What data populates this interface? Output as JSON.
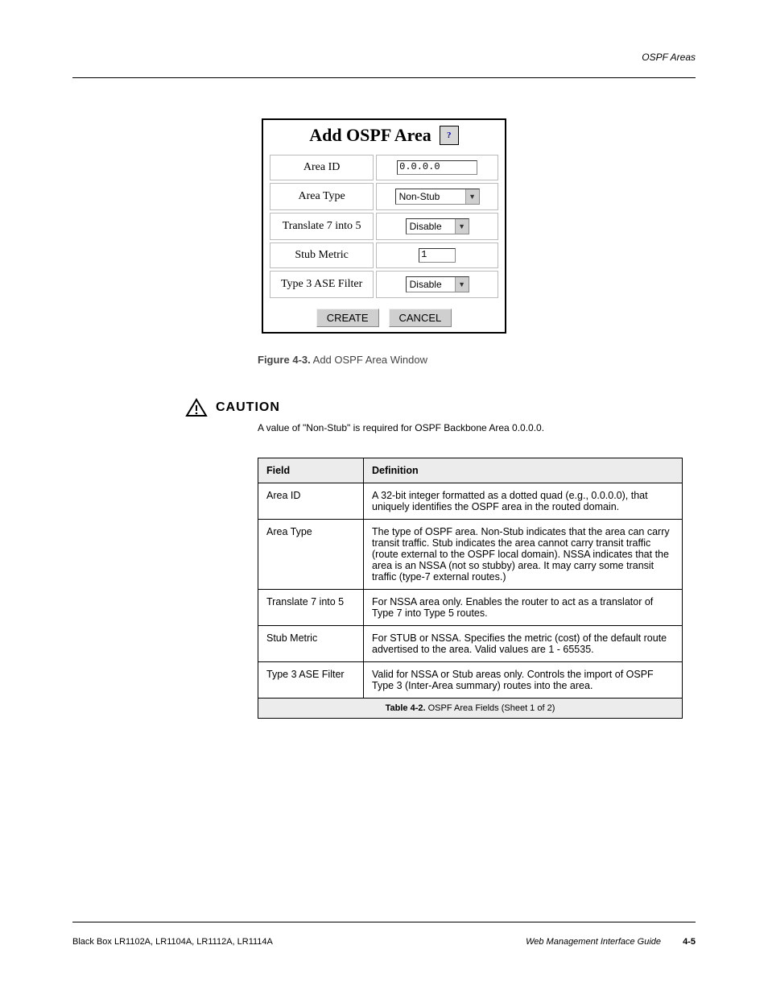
{
  "header": {
    "running_title": "OSPF Areas"
  },
  "screenshot": {
    "title": "Add OSPF Area",
    "help_icon_label": "?",
    "fields": {
      "area_id": {
        "label": "Area ID",
        "value": "0.0.0.0"
      },
      "area_type": {
        "label": "Area Type",
        "value": "Non-Stub"
      },
      "translate": {
        "label": "Translate 7 into 5",
        "value": "Disable"
      },
      "stub_metric": {
        "label": "Stub Metric",
        "value": "1"
      },
      "type3_filter": {
        "label": "Type 3 ASE Filter",
        "value": "Disable"
      }
    },
    "buttons": {
      "create": "CREATE",
      "cancel": "CANCEL"
    }
  },
  "figure_caption": {
    "label": "Figure 4-3.",
    "text": "Add OSPF Area Window"
  },
  "caution": {
    "word": "CAUTION",
    "text": "A value of \"Non-Stub\" is required for OSPF Backbone Area 0.0.0.0."
  },
  "fields_table": {
    "headers": {
      "col1": "Field",
      "col2": "Definition"
    },
    "rows": [
      {
        "field": "Area ID",
        "definition": "A 32-bit integer formatted as a dotted quad (e.g., 0.0.0.0), that uniquely identifies the OSPF area in the routed domain."
      },
      {
        "field": "Area Type",
        "definition": "The type of OSPF area. Non-Stub indicates that the area can carry transit traffic. Stub indicates the area cannot carry transit traffic (route external to the OSPF local domain). NSSA indicates that the area is an NSSA (not so stubby) area. It may carry some transit traffic (type-7 external routes.)"
      },
      {
        "field": "Translate 7 into 5",
        "definition": "For NSSA area only. Enables the router to act as a translator of Type 7 into Type 5 routes."
      },
      {
        "field": "Stub Metric",
        "definition": "For STUB or NSSA. Specifies the metric (cost) of the default route advertised to the area. Valid values are 1 - 65535."
      },
      {
        "field": "Type 3 ASE Filter",
        "definition": "Valid for NSSA or Stub areas only. Controls the import of OSPF Type 3 (Inter-Area summary) routes into the area."
      }
    ],
    "caption": {
      "label": "Table 4-2.",
      "text": "OSPF Area Fields (Sheet 1 of 2)"
    }
  },
  "footer": {
    "left": "Black Box LR1102A, LR1104A, LR1112A, LR1114A",
    "right_title": "Web Management Interface Guide",
    "page_number": "4-5"
  }
}
